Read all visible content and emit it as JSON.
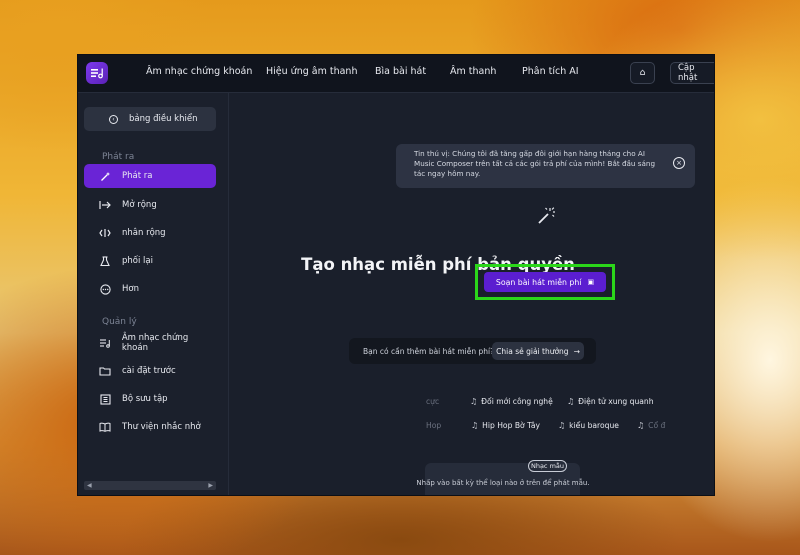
{
  "topbar": {
    "nav": [
      "Âm nhạc chứng khoán",
      "Hiệu ứng âm thanh",
      "Bìa bài hát",
      "Âm thanh",
      "Phân tích AI"
    ],
    "update_label": "Cập nhật"
  },
  "sidebar": {
    "dashboard_label": "bảng điều khiển",
    "section_create": "Phát ra",
    "create_items": [
      {
        "label": "Phát ra",
        "icon": "wand-icon",
        "active": true
      },
      {
        "label": "Mở rộng",
        "icon": "expand-arrow-icon"
      },
      {
        "label": "nhân rộng",
        "icon": "replicate-icon"
      },
      {
        "label": "phối lại",
        "icon": "flask-icon"
      },
      {
        "label": "Hơn",
        "icon": "more-icon"
      }
    ],
    "section_manage": "Quản lý",
    "manage_items": [
      {
        "label": "Âm nhạc chứng khoán",
        "icon": "music-list-icon"
      },
      {
        "label": "cài đặt trước",
        "icon": "folder-icon"
      },
      {
        "label": "Bộ sưu tập",
        "icon": "collection-icon"
      },
      {
        "label": "Thư viện nhắc nhở",
        "icon": "book-icon"
      }
    ]
  },
  "main": {
    "notice": "Tin thú vị: Chúng tôi đã tăng gấp đôi giới hạn hàng tháng cho AI Music Composer trên tất cả các gói trả phí của mình! Bắt đầu sáng tác ngay hôm nay.",
    "title": "Tạo nhạc miễn phí bản quyền",
    "compose_button": "Soạn bài hát miễn phí",
    "promo_text": "Bạn có cần thêm bài hát miễn phí?",
    "promo_button": "Chia sẻ giải thưởng",
    "genres_row1": [
      "cực",
      "Đối mới công nghệ",
      "Điện tử xung quanh"
    ],
    "genres_row2": [
      "Hop",
      "Hip Hop Bờ Tây",
      "kiểu baroque",
      "Cổ đ"
    ],
    "sample_tag": "Nhạc mẫu",
    "sample_text": "Nhấp vào bất kỳ thể loại nào ở trên để phát mẫu."
  },
  "colors": {
    "accent": "#6a24d6",
    "highlight_box": "#2bd61a",
    "app_bg": "#171c28"
  }
}
